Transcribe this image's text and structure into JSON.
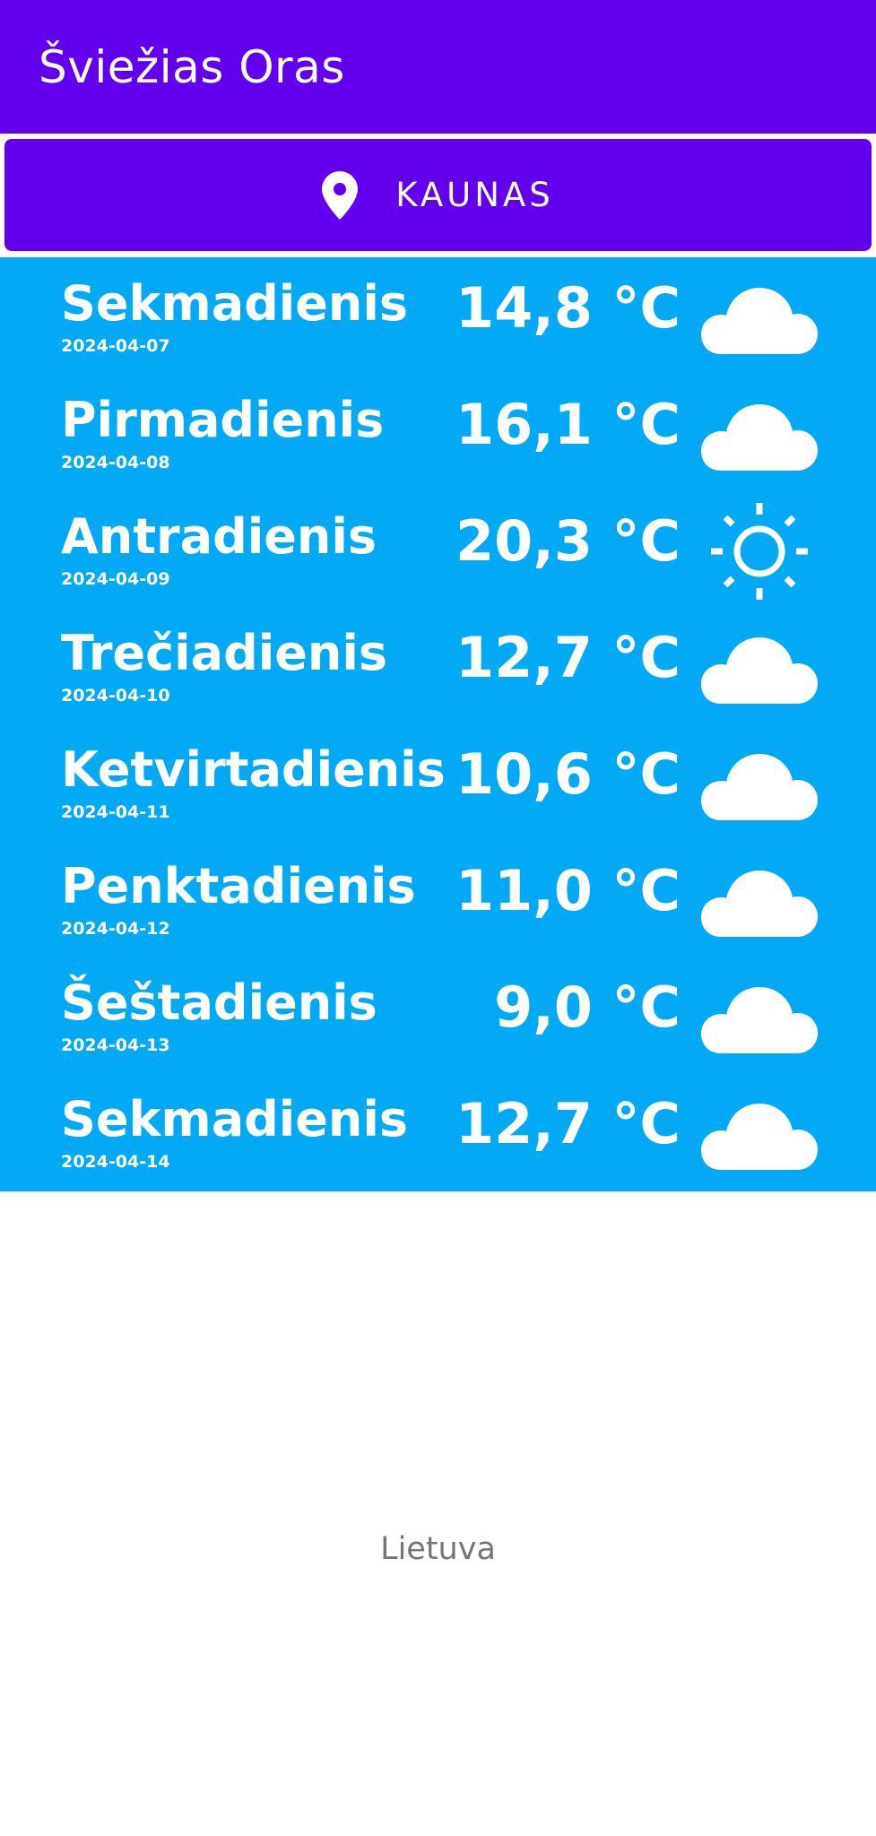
{
  "app_bar": {
    "title": "Šviežias Oras"
  },
  "location": {
    "label": "KAUNAS",
    "icon": "location-pin-icon"
  },
  "forecast": [
    {
      "day": "Sekmadienis",
      "date": "2024-04-07",
      "temp": "14,8 °C",
      "icon": "cloud-icon"
    },
    {
      "day": "Pirmadienis",
      "date": "2024-04-08",
      "temp": "16,1 °C",
      "icon": "cloud-icon"
    },
    {
      "day": "Antradienis",
      "date": "2024-04-09",
      "temp": "20,3 °C",
      "icon": "sun-icon"
    },
    {
      "day": "Trečiadienis",
      "date": "2024-04-10",
      "temp": "12,7 °C",
      "icon": "cloud-icon"
    },
    {
      "day": "Ketvirtadienis",
      "date": "2024-04-11",
      "temp": "10,6 °C",
      "icon": "cloud-icon"
    },
    {
      "day": "Penktadienis",
      "date": "2024-04-12",
      "temp": "11,0 °C",
      "icon": "cloud-icon"
    },
    {
      "day": "Šeštadienis",
      "date": "2024-04-13",
      "temp": "9,0 °C",
      "icon": "cloud-icon"
    },
    {
      "day": "Sekmadienis",
      "date": "2024-04-14",
      "temp": "12,7 °C",
      "icon": "cloud-icon"
    }
  ],
  "footer": {
    "text": "Lietuva"
  },
  "colors": {
    "primary": "#6200ee",
    "forecast_background": "#03a9f4",
    "text_on_primary": "#ffffff",
    "footer_text": "#757575"
  }
}
